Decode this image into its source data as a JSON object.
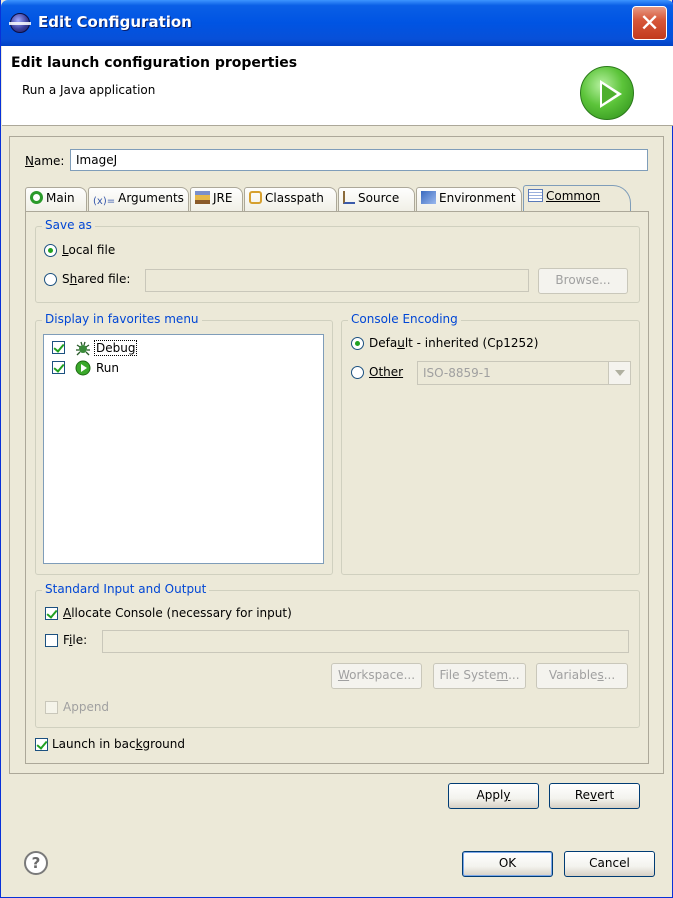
{
  "window": {
    "title": "Edit Configuration",
    "close_glyph": "✕"
  },
  "header": {
    "title": "Edit launch configuration properties",
    "subtitle": "Run a Java application",
    "icon": "run-launch-icon"
  },
  "name_field": {
    "label_accel": "N",
    "label_rest": "ame:",
    "value": "ImageJ"
  },
  "tabs": [
    {
      "label": "Main",
      "icon": "main-tab-icon"
    },
    {
      "label": "Arguments",
      "icon": "arguments-icon"
    },
    {
      "label": "JRE",
      "icon": "jre-icon"
    },
    {
      "label": "Classpath",
      "icon": "classpath-icon"
    },
    {
      "label": "Source",
      "icon": "source-icon"
    },
    {
      "label": "Environment",
      "icon": "environment-icon"
    },
    {
      "label": "Common",
      "icon": "common-icon",
      "active": true
    }
  ],
  "save_as": {
    "title": "Save as",
    "local_accel": "L",
    "local_rest": "ocal file",
    "shared_pre": "S",
    "shared_accel": "h",
    "shared_rest": "ared file:",
    "shared_value": "",
    "browse_label": "Browse...",
    "selected": "local"
  },
  "favorites": {
    "title": "Display in favorites menu",
    "items": [
      {
        "label": "Debug",
        "checked": true,
        "icon": "debug-icon"
      },
      {
        "label": "Run",
        "checked": true,
        "icon": "run-icon"
      }
    ]
  },
  "console_encoding": {
    "title": "Console Encoding",
    "default_pre": "Defa",
    "default_accel": "u",
    "default_rest": "lt - inherited (Cp1252)",
    "other_accel": "Other",
    "other_value": "ISO-8859-1",
    "selected": "default"
  },
  "std_io": {
    "title": "Standard Input and Output",
    "allocate_accel": "A",
    "allocate_rest": "llocate Console (necessary for input)",
    "allocate_checked": true,
    "file_pre": "F",
    "file_accel": "i",
    "file_rest": "le:",
    "file_value": "",
    "file_checked": false,
    "workspace_accel": "W",
    "workspace_rest": "orkspace...",
    "filesystem_pre": "File Syste",
    "filesystem_accel": "m",
    "filesystem_rest": "...",
    "variables_pre": "Variable",
    "variables_accel": "s",
    "variables_rest": "...",
    "append_label": "Append",
    "append_checked": false
  },
  "launch_bg": {
    "pre": "Launch in bac",
    "accel": "k",
    "rest": "ground",
    "checked": true
  },
  "buttons": {
    "apply_pre": "Appl",
    "apply_accel": "y",
    "revert_pre": "Re",
    "revert_accel": "v",
    "revert_rest": "ert",
    "ok": "OK",
    "cancel": "Cancel"
  },
  "help": {
    "glyph": "?"
  }
}
